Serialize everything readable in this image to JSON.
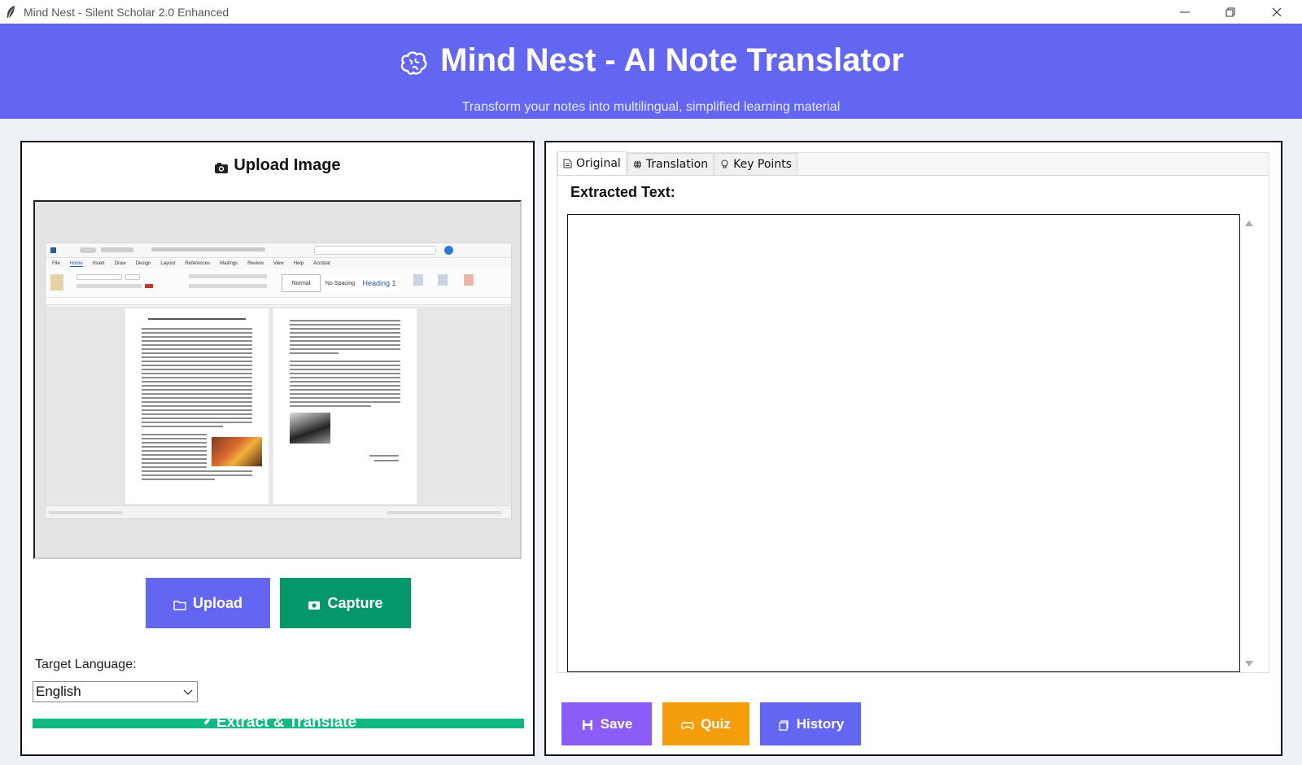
{
  "window": {
    "title": "Mind Nest - Silent Scholar 2.0 Enhanced",
    "icon": "feather-icon"
  },
  "header": {
    "title": "Mind Nest - AI Note Translator",
    "subtitle": "Transform your notes into multilingual, simplified learning material",
    "icon": "brain-icon",
    "background": "#6366f1"
  },
  "upload_panel": {
    "heading": "Upload Image",
    "heading_icon": "camera-icon",
    "upload_label": "Upload",
    "capture_label": "Capture",
    "target_language_label": "Target Language:",
    "target_language_value": "English",
    "extract_label": "Extract & Translate",
    "extract_icon": "rocket-icon"
  },
  "preview_doc": {
    "menus": [
      "File",
      "Home",
      "Insert",
      "Draw",
      "Design",
      "Layout",
      "References",
      "Mailings",
      "Review",
      "View",
      "Help",
      "Acrobat"
    ],
    "styles": [
      "Normal",
      "No Spacing",
      "Heading 1"
    ]
  },
  "output_panel": {
    "tabs": [
      {
        "label": "Original",
        "icon": "page-icon"
      },
      {
        "label": "Translation",
        "icon": "globe-icon"
      },
      {
        "label": "Key Points",
        "icon": "lightbulb-icon"
      }
    ],
    "extracted_label": "Extracted Text:",
    "extracted_text": ""
  },
  "actions": {
    "save_label": "Save",
    "quiz_label": "Quiz",
    "history_label": "History"
  },
  "colors": {
    "primary": "#6366f1",
    "capture": "#059669",
    "extract": "#10b981",
    "save": "#8b5cf6",
    "quiz": "#f59e0b"
  }
}
